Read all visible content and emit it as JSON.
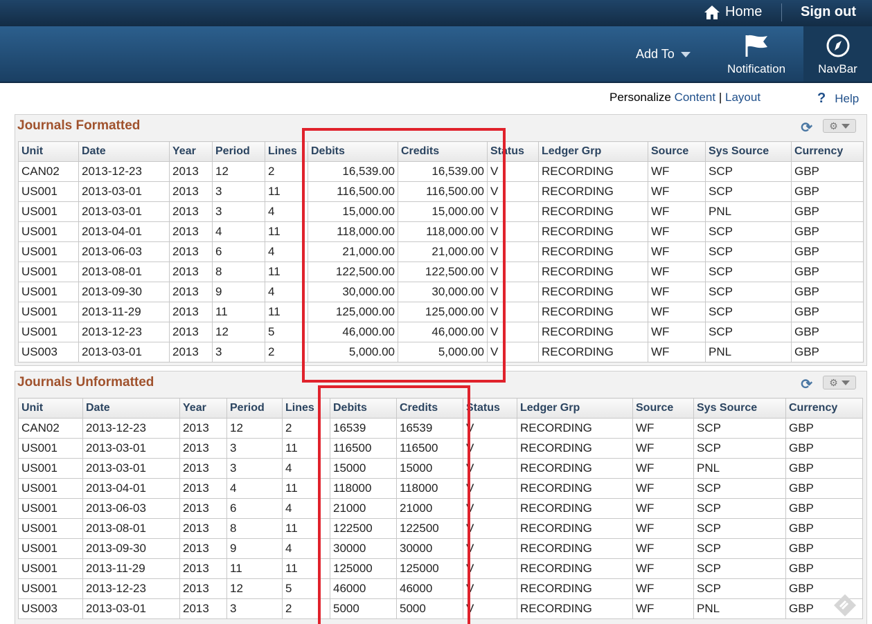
{
  "header": {
    "home_label": "Home",
    "signout_label": "Sign out",
    "addto_label": "Add To",
    "notification_label": "Notification",
    "navbar_label": "NavBar"
  },
  "toolbar": {
    "personalize_label": "Personalize",
    "content_link": "Content",
    "separator": "|",
    "layout_link": "Layout",
    "help_icon": "?",
    "help_label": "Help"
  },
  "formatted": {
    "title": "Journals Formatted",
    "columns": [
      "Unit",
      "Date",
      "Year",
      "Period",
      "Lines",
      "Debits",
      "Credits",
      "Status",
      "Ledger Grp",
      "Source",
      "Sys Source",
      "Currency"
    ],
    "rows": [
      [
        "CAN02",
        "2013-12-23",
        "2013",
        "12",
        "2",
        "16,539.00",
        "16,539.00",
        "V",
        "RECORDING",
        "WF",
        "SCP",
        "GBP"
      ],
      [
        "US001",
        "2013-03-01",
        "2013",
        "3",
        "11",
        "116,500.00",
        "116,500.00",
        "V",
        "RECORDING",
        "WF",
        "SCP",
        "GBP"
      ],
      [
        "US001",
        "2013-03-01",
        "2013",
        "3",
        "4",
        "15,000.00",
        "15,000.00",
        "V",
        "RECORDING",
        "WF",
        "PNL",
        "GBP"
      ],
      [
        "US001",
        "2013-04-01",
        "2013",
        "4",
        "11",
        "118,000.00",
        "118,000.00",
        "V",
        "RECORDING",
        "WF",
        "SCP",
        "GBP"
      ],
      [
        "US001",
        "2013-06-03",
        "2013",
        "6",
        "4",
        "21,000.00",
        "21,000.00",
        "V",
        "RECORDING",
        "WF",
        "SCP",
        "GBP"
      ],
      [
        "US001",
        "2013-08-01",
        "2013",
        "8",
        "11",
        "122,500.00",
        "122,500.00",
        "V",
        "RECORDING",
        "WF",
        "SCP",
        "GBP"
      ],
      [
        "US001",
        "2013-09-30",
        "2013",
        "9",
        "4",
        "30,000.00",
        "30,000.00",
        "V",
        "RECORDING",
        "WF",
        "SCP",
        "GBP"
      ],
      [
        "US001",
        "2013-11-29",
        "2013",
        "11",
        "11",
        "125,000.00",
        "125,000.00",
        "V",
        "RECORDING",
        "WF",
        "SCP",
        "GBP"
      ],
      [
        "US001",
        "2013-12-23",
        "2013",
        "12",
        "5",
        "46,000.00",
        "46,000.00",
        "V",
        "RECORDING",
        "WF",
        "SCP",
        "GBP"
      ],
      [
        "US003",
        "2013-03-01",
        "2013",
        "3",
        "2",
        "5,000.00",
        "5,000.00",
        "V",
        "RECORDING",
        "WF",
        "PNL",
        "GBP"
      ]
    ]
  },
  "unformatted": {
    "title": "Journals Unformatted",
    "columns": [
      "Unit",
      "Date",
      "Year",
      "Period",
      "Lines",
      "Debits",
      "Credits",
      "Status",
      "Ledger Grp",
      "Source",
      "Sys Source",
      "Currency"
    ],
    "rows": [
      [
        "CAN02",
        "2013-12-23",
        "2013",
        "12",
        "2",
        "16539",
        "16539",
        "V",
        "RECORDING",
        "WF",
        "SCP",
        "GBP"
      ],
      [
        "US001",
        "2013-03-01",
        "2013",
        "3",
        "11",
        "116500",
        "116500",
        "V",
        "RECORDING",
        "WF",
        "SCP",
        "GBP"
      ],
      [
        "US001",
        "2013-03-01",
        "2013",
        "3",
        "4",
        "15000",
        "15000",
        "V",
        "RECORDING",
        "WF",
        "PNL",
        "GBP"
      ],
      [
        "US001",
        "2013-04-01",
        "2013",
        "4",
        "11",
        "118000",
        "118000",
        "V",
        "RECORDING",
        "WF",
        "SCP",
        "GBP"
      ],
      [
        "US001",
        "2013-06-03",
        "2013",
        "6",
        "4",
        "21000",
        "21000",
        "V",
        "RECORDING",
        "WF",
        "SCP",
        "GBP"
      ],
      [
        "US001",
        "2013-08-01",
        "2013",
        "8",
        "11",
        "122500",
        "122500",
        "V",
        "RECORDING",
        "WF",
        "SCP",
        "GBP"
      ],
      [
        "US001",
        "2013-09-30",
        "2013",
        "9",
        "4",
        "30000",
        "30000",
        "V",
        "RECORDING",
        "WF",
        "SCP",
        "GBP"
      ],
      [
        "US001",
        "2013-11-29",
        "2013",
        "11",
        "11",
        "125000",
        "125000",
        "V",
        "RECORDING",
        "WF",
        "SCP",
        "GBP"
      ],
      [
        "US001",
        "2013-12-23",
        "2013",
        "12",
        "5",
        "46000",
        "46000",
        "V",
        "RECORDING",
        "WF",
        "SCP",
        "GBP"
      ],
      [
        "US003",
        "2013-03-01",
        "2013",
        "3",
        "2",
        "5000",
        "5000",
        "V",
        "RECORDING",
        "WF",
        "PNL",
        "GBP"
      ]
    ]
  },
  "colors": {
    "highlight": "#e0222c",
    "title": "#a0522d",
    "header_bg": "#1f4468"
  }
}
